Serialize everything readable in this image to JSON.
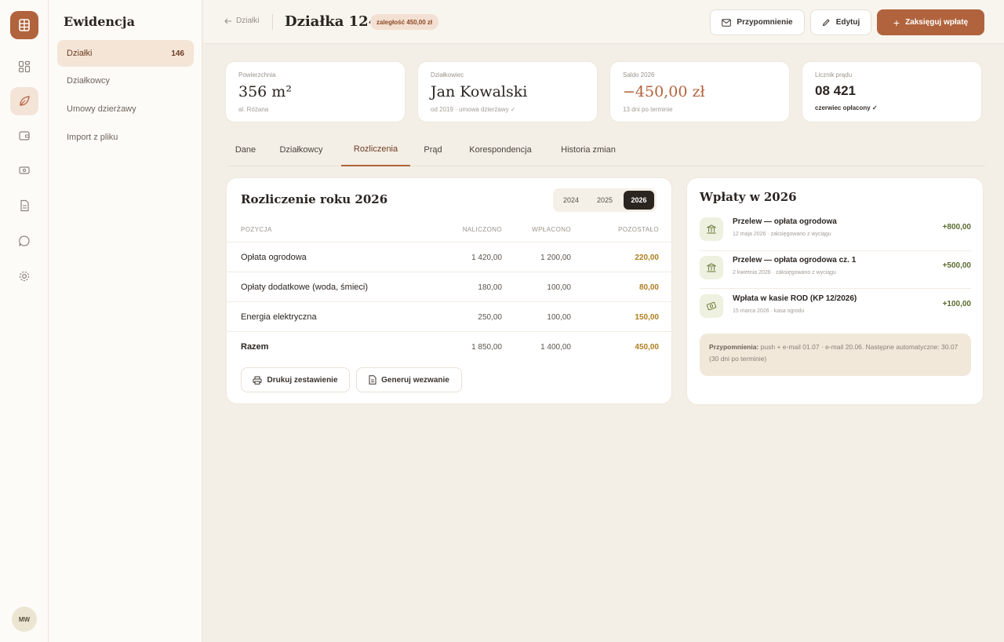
{
  "rail": {
    "avatar_initials": "MW",
    "icons": [
      "dashboard-icon",
      "leaf-icon",
      "wallet-icon",
      "ticket-icon",
      "document-icon",
      "chat-icon",
      "settings-icon"
    ]
  },
  "sidebar": {
    "title": "Ewidencja",
    "items": [
      {
        "label": "Działki",
        "count": "146"
      },
      {
        "label": "Działkowcy"
      },
      {
        "label": "Umowy dzierżawy"
      },
      {
        "label": "Import z pliku"
      }
    ]
  },
  "header": {
    "back_label": "Działki",
    "title": "Działka 124",
    "badge": "zaległość 450,00 zł",
    "reminder_button": "Przypomnienie",
    "edit_button": "Edytuj",
    "primary_button": "Zaksięguj wpłatę"
  },
  "stats": [
    {
      "label": "Powierzchnia",
      "value": "356 m²",
      "sub": "al. Różana"
    },
    {
      "label": "Działkowiec",
      "value": "Jan Kowalski",
      "sub": "od 2019 · umowa dzierżawy ✓"
    },
    {
      "label": "Saldo 2026",
      "value": "−450,00 zł",
      "sub": "13 dni po terminie"
    },
    {
      "label": "Licznik prądu",
      "value": "08 421",
      "sub": "czerwiec opłacony ✓"
    }
  ],
  "tabs": [
    "Dane",
    "Działkowcy",
    "Rozliczenia",
    "Prąd",
    "Korespondencja",
    "Historia zmian"
  ],
  "settlement": {
    "title": "Rozliczenie roku 2026",
    "years": [
      "2024",
      "2025",
      "2026"
    ],
    "columns": [
      "POZYCJA",
      "NALICZONO",
      "WPŁACONO",
      "POZOSTAŁO"
    ],
    "rows": [
      {
        "name": "Opłata ogrodowa",
        "charged": "1 420,00",
        "paid": "1 200,00",
        "remaining": "220,00"
      },
      {
        "name": "Opłaty dodatkowe (woda, śmieci)",
        "charged": "180,00",
        "paid": "100,00",
        "remaining": "80,00"
      },
      {
        "name": "Energia elektryczna",
        "charged": "250,00",
        "paid": "100,00",
        "remaining": "150,00"
      },
      {
        "name": "Razem",
        "charged": "1 850,00",
        "paid": "1 400,00",
        "remaining": "450,00"
      }
    ],
    "print_button": "Drukuj zestawienie",
    "summon_button": "Generuj wezwanie"
  },
  "payments": {
    "title": "Wpłaty w 2026",
    "items": [
      {
        "title": "Przelew — opłata ogrodowa",
        "sub": "12 maja 2026 · zaksięgowano z wyciągu",
        "amount": "+800,00",
        "icon": "bank-icon"
      },
      {
        "title": "Przelew — opłata ogrodowa cz. 1",
        "sub": "2 kwietnia 2026 · zaksięgowano z wyciągu",
        "amount": "+500,00",
        "icon": "bank-icon"
      },
      {
        "title": "Wpłata w kasie ROD (KP 12/2026)",
        "sub": "15 marca 2026 · kasa ogrodu",
        "amount": "+100,00",
        "icon": "cash-icon"
      }
    ],
    "reminder_label": "Przypomnienia:",
    "reminder_text": "push + e-mail 01.07 · e-mail 20.06. Następne automatyczne: 30.07 (30 dni po terminie)"
  },
  "colors": {
    "accent": "#b0633c",
    "background": "#f3eee6",
    "positive": "#5a6b2e",
    "warning": "#b07d1f"
  }
}
